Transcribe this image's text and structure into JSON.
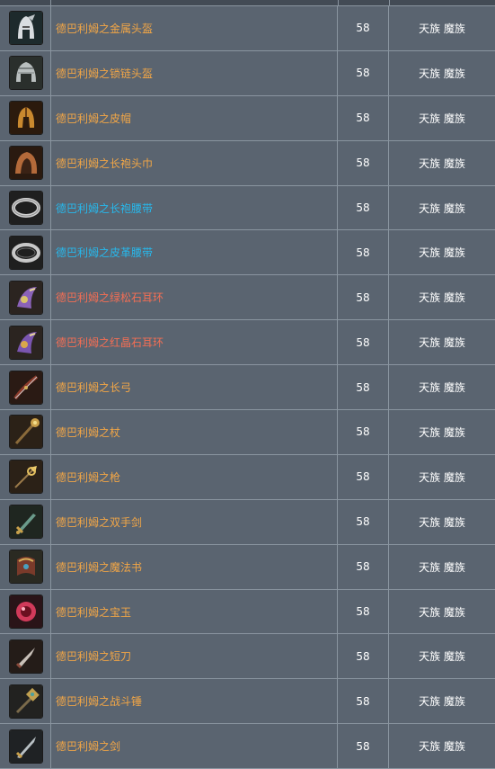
{
  "table": {
    "rows": [
      {
        "name": "德巴利姆之金属头盔",
        "level": "58",
        "race": "天族 魔族",
        "color": "orange",
        "icon": "metal-helmet-icon"
      },
      {
        "name": "德巴利姆之锁链头盔",
        "level": "58",
        "race": "天族 魔族",
        "color": "orange",
        "icon": "chain-helmet-icon"
      },
      {
        "name": "德巴利姆之皮帽",
        "level": "58",
        "race": "天族 魔族",
        "color": "orange",
        "icon": "leather-cap-icon"
      },
      {
        "name": "德巴利姆之长袍头巾",
        "level": "58",
        "race": "天族 魔族",
        "color": "orange",
        "icon": "robe-hood-icon"
      },
      {
        "name": "德巴利姆之长袍腰带",
        "level": "58",
        "race": "天族 魔族",
        "color": "blue",
        "icon": "robe-belt-icon"
      },
      {
        "name": "德巴利姆之皮革腰带",
        "level": "58",
        "race": "天族 魔族",
        "color": "blue",
        "icon": "leather-belt-icon"
      },
      {
        "name": "德巴利姆之绿松石耳环",
        "level": "58",
        "race": "天族 魔族",
        "color": "red",
        "icon": "turquoise-earring-icon"
      },
      {
        "name": "德巴利姆之红晶石耳环",
        "level": "58",
        "race": "天族 魔族",
        "color": "red",
        "icon": "ruby-earring-icon"
      },
      {
        "name": "德巴利姆之长弓",
        "level": "58",
        "race": "天族 魔族",
        "color": "orange",
        "icon": "longbow-icon"
      },
      {
        "name": "德巴利姆之杖",
        "level": "58",
        "race": "天族 魔族",
        "color": "orange",
        "icon": "staff-icon"
      },
      {
        "name": "德巴利姆之枪",
        "level": "58",
        "race": "天族 魔族",
        "color": "orange",
        "icon": "spear-icon"
      },
      {
        "name": "德巴利姆之双手剑",
        "level": "58",
        "race": "天族 魔族",
        "color": "orange",
        "icon": "greatsword-icon"
      },
      {
        "name": "德巴利姆之魔法书",
        "level": "58",
        "race": "天族 魔族",
        "color": "orange",
        "icon": "spellbook-icon"
      },
      {
        "name": "德巴利姆之宝玉",
        "level": "58",
        "race": "天族 魔族",
        "color": "orange",
        "icon": "orb-icon"
      },
      {
        "name": "德巴利姆之短刀",
        "level": "58",
        "race": "天族 魔族",
        "color": "orange",
        "icon": "dagger-icon"
      },
      {
        "name": "德巴利姆之战斗锤",
        "level": "58",
        "race": "天族 魔族",
        "color": "orange",
        "icon": "warhammer-icon"
      },
      {
        "name": "德巴利姆之剑",
        "level": "58",
        "race": "天族 魔族",
        "color": "orange",
        "icon": "sword-icon"
      }
    ]
  },
  "colors": {
    "orange": "#f2a646",
    "blue": "#27b8ec",
    "red": "#f46e54",
    "background": "#5a6470",
    "border": "#8a95a0"
  }
}
